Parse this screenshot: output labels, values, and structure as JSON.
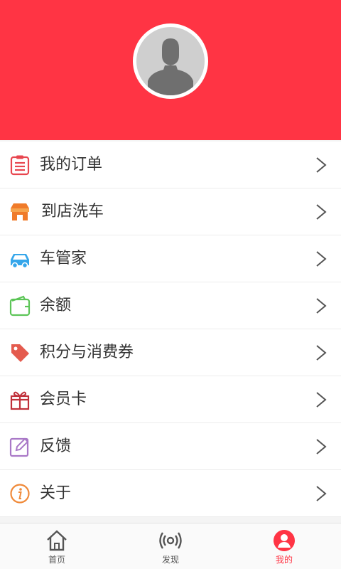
{
  "colors": {
    "brand": "#ff3444",
    "text": "#333333",
    "tab_inactive": "#555555"
  },
  "menu": {
    "items": [
      {
        "label": "我的订单",
        "icon": "order-list-icon",
        "icon_color": "#e8464f"
      },
      {
        "label": "到店洗车",
        "icon": "store-icon",
        "icon_color": "#f07b2a"
      },
      {
        "label": "车管家",
        "icon": "car-icon",
        "icon_color": "#35a6ea"
      },
      {
        "label": "余额",
        "icon": "wallet-icon",
        "icon_color": "#5cc557"
      },
      {
        "label": "积分与消费券",
        "icon": "tag-icon",
        "icon_color": "#e45b4e"
      },
      {
        "label": "会员卡",
        "icon": "gift-icon",
        "icon_color": "#c0303a"
      },
      {
        "label": "反馈",
        "icon": "edit-icon",
        "icon_color": "#a978c7"
      },
      {
        "label": "关于",
        "icon": "info-icon",
        "icon_color": "#f08a3a"
      }
    ]
  },
  "tabbar": {
    "tabs": [
      {
        "label": "首页",
        "icon": "home-icon",
        "active": false
      },
      {
        "label": "发现",
        "icon": "broadcast-icon",
        "active": false
      },
      {
        "label": "我的",
        "icon": "profile-icon",
        "active": true
      }
    ]
  }
}
